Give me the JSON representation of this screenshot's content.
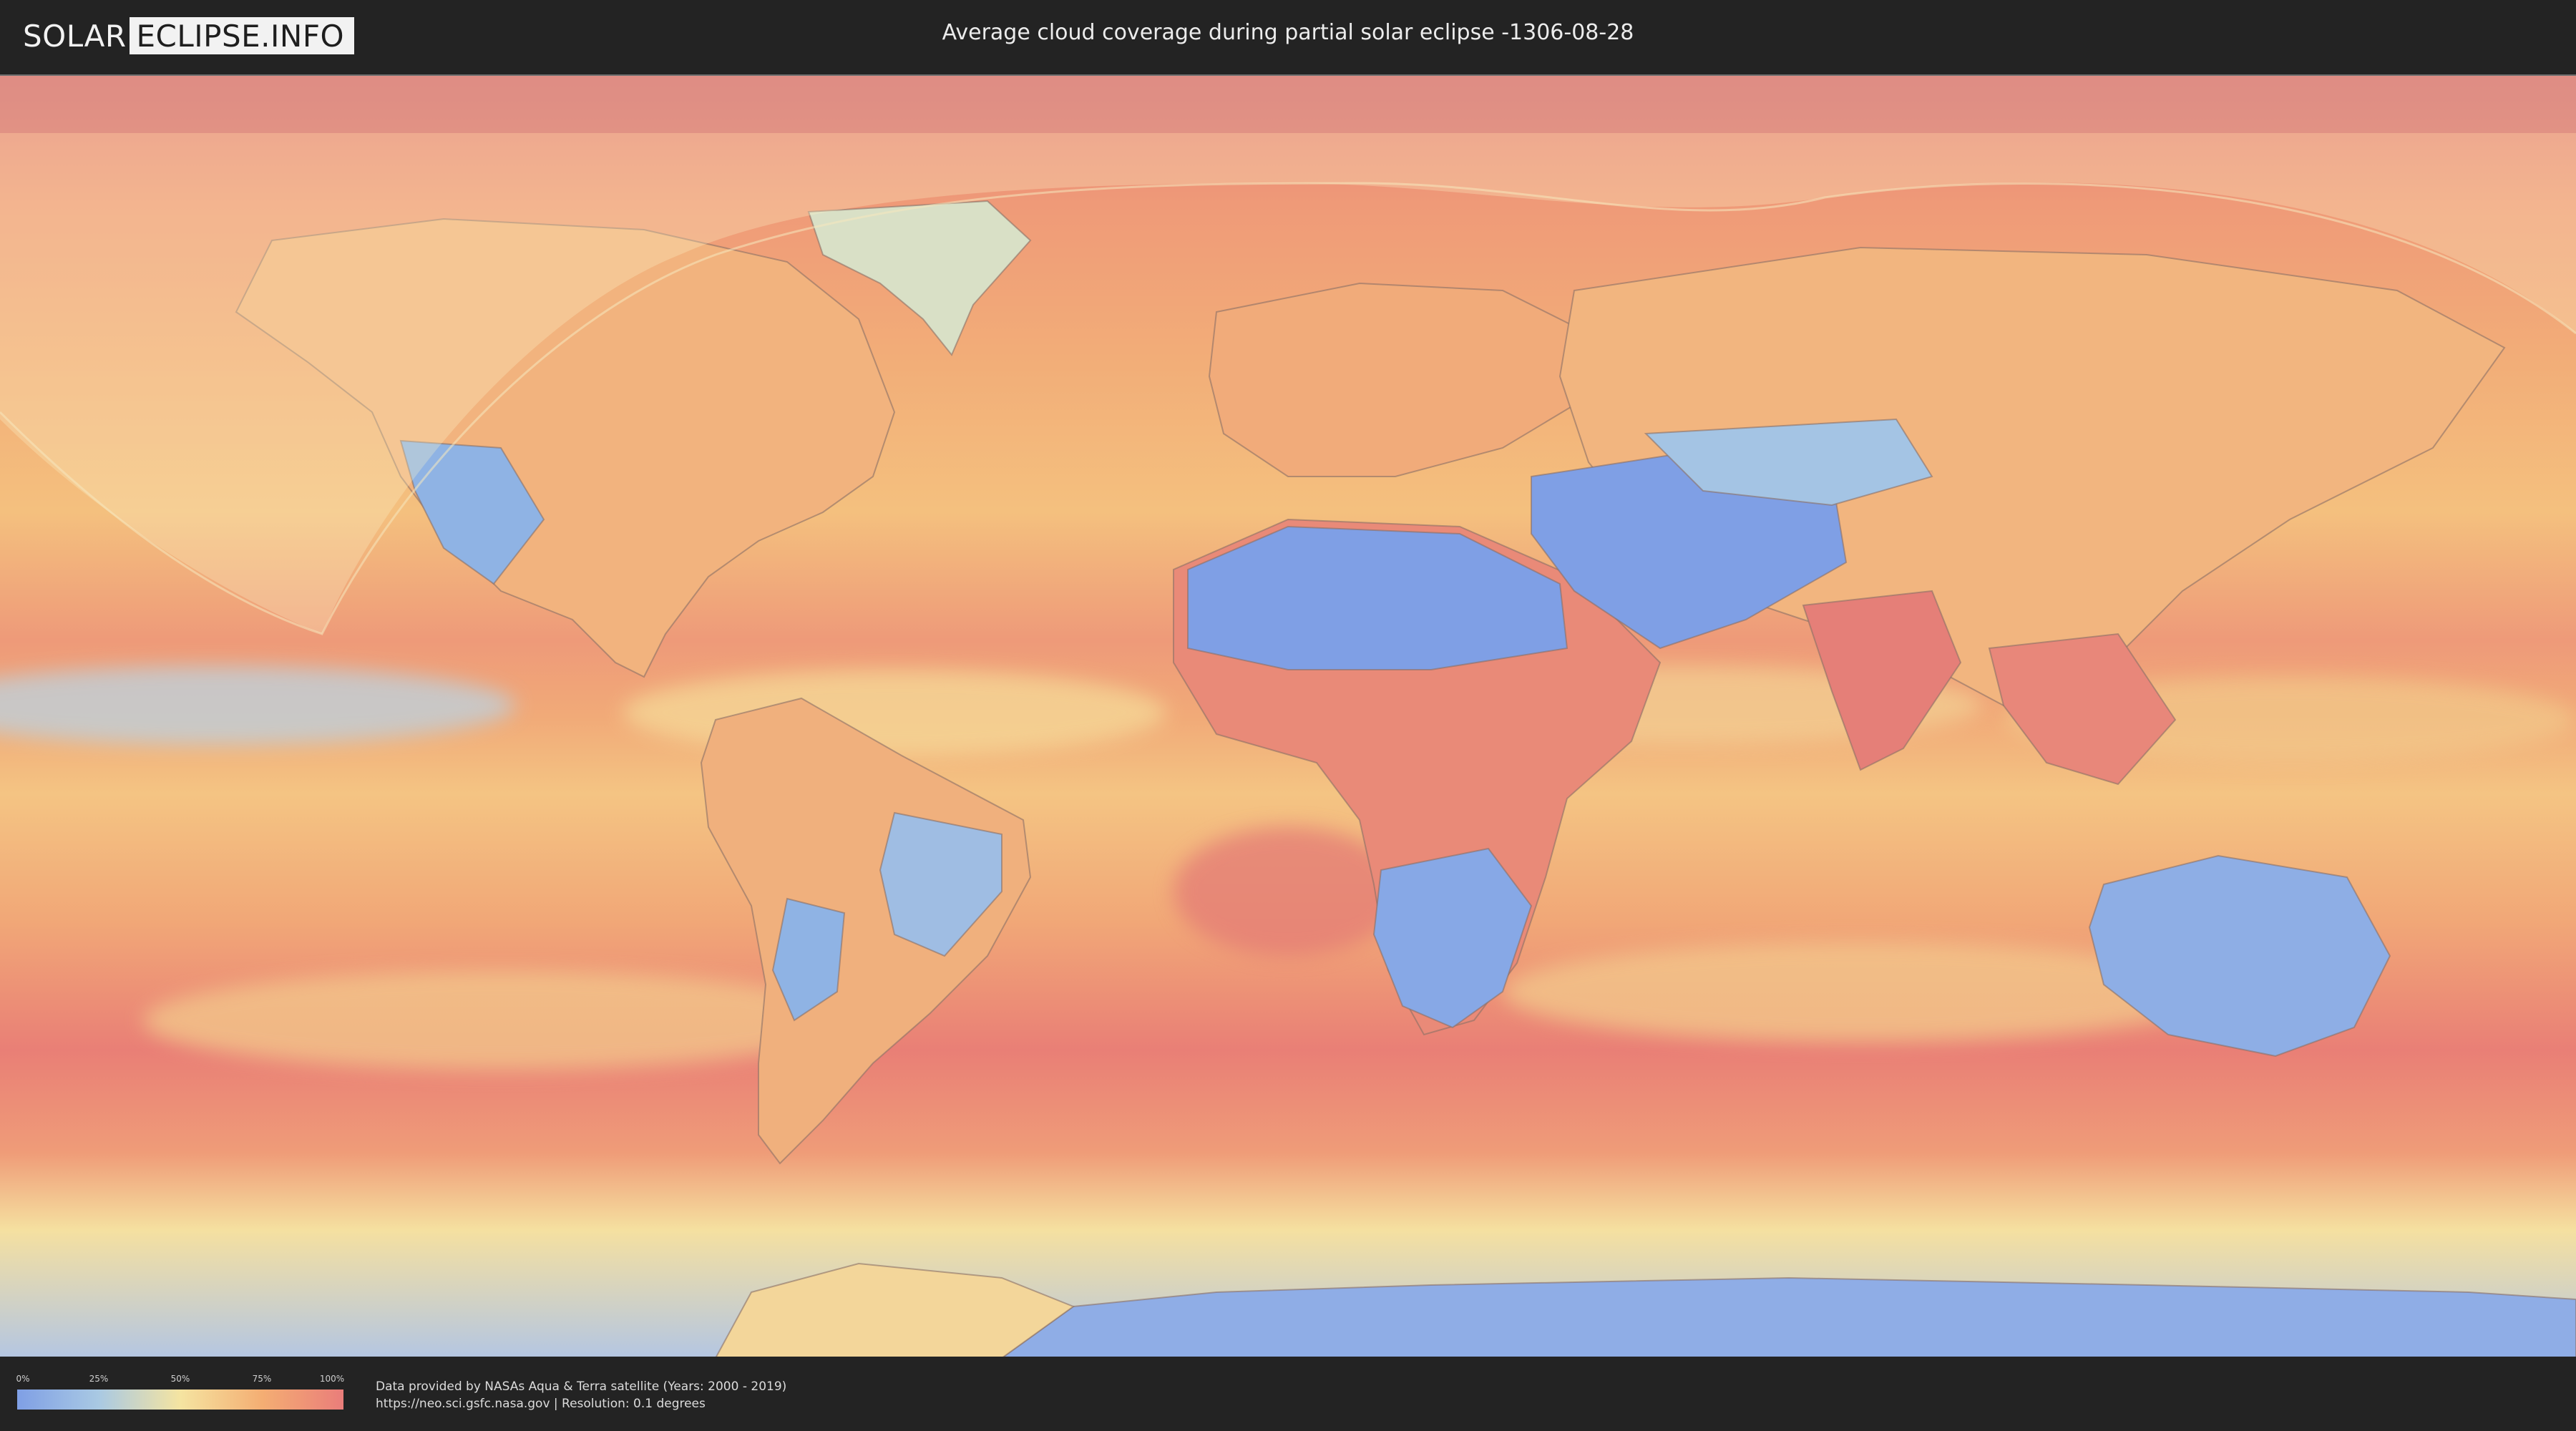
{
  "header": {
    "logo_left": "SOLAR",
    "logo_right": "ECLIPSE.INFO",
    "title": "Average cloud coverage during partial solar eclipse -1306-08-28"
  },
  "legend": {
    "ticks": [
      "0%",
      "25%",
      "50%",
      "75%",
      "100%"
    ],
    "colors": [
      "#7f9fe5",
      "#a9c9e3",
      "#f5e4a1",
      "#f4ae73",
      "#ea7d7a"
    ]
  },
  "credits": {
    "line1": "Data provided by NASAs Aqua & Terra satellite (Years: 2000 - 2019)",
    "line2": "https://neo.sci.gsfc.nasa.gov | Resolution: 0.1 degrees"
  },
  "map": {
    "projection": "equirectangular",
    "ocean_color": "#ee9378",
    "clear_land_color": "#7f9fe5",
    "eclipse_overlay_color": "#f3e1b0"
  }
}
